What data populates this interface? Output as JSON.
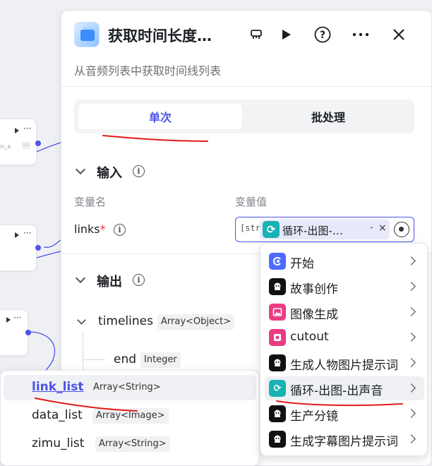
{
  "canvas": {
    "node_dots": "···",
    "node_small_text": "in_a"
  },
  "panel": {
    "title": "获取时间长度…",
    "description": "从音频列表中获取时间线列表",
    "tabs": [
      {
        "label": "单次",
        "active": true
      },
      {
        "label": "批处理",
        "active": false
      }
    ],
    "input": {
      "title": "输入",
      "col_name": "变量名",
      "col_value": "变量值",
      "var_name": "links",
      "required_mark": "*",
      "type_tag": "[str]",
      "ref_label": "循环-出图-…",
      "ref_sep": "-",
      "ref_clear": "×"
    },
    "output": {
      "title": "输出",
      "items": [
        {
          "name": "timelines",
          "type": "Array<Object>"
        },
        {
          "name": "end",
          "type": "Integer"
        }
      ]
    }
  },
  "output_dropdown": {
    "items": [
      {
        "name": "link_list",
        "type": "Array<String>",
        "selected": true
      },
      {
        "name": "data_list",
        "type": "Array<Image>",
        "selected": false
      },
      {
        "name": "zimu_list",
        "type": "Array<String>",
        "selected": false
      }
    ]
  },
  "node_menu": {
    "items": [
      {
        "label": "开始",
        "icon": "start-icon",
        "color": "#4d6bfe"
      },
      {
        "label": "故事创作",
        "icon": "llm-icon",
        "color": "#111111"
      },
      {
        "label": "图像生成",
        "icon": "image-icon",
        "color": "#e93d82"
      },
      {
        "label": "cutout",
        "icon": "plugin-icon",
        "color": "#e93d82"
      },
      {
        "label": "生成人物图片提示词",
        "icon": "llm-icon",
        "color": "#111111"
      },
      {
        "label": "循环-出图-出声音",
        "icon": "loop-icon",
        "color": "#19b2b3",
        "hover": true
      },
      {
        "label": "生产分镜",
        "icon": "llm-icon",
        "color": "#111111"
      },
      {
        "label": "生成字幕图片提示词",
        "icon": "llm-icon",
        "color": "#111111"
      }
    ]
  },
  "colors": {
    "accent": "#4d53e8",
    "annotation": "#e01b1b"
  }
}
